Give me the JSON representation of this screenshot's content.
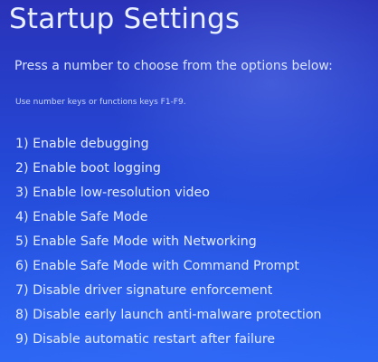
{
  "title": "Startup Settings",
  "subtitle": "Press a number to choose from the options below:",
  "hint": "Use number keys or functions keys F1-F9.",
  "options": [
    {
      "label": "1) Enable debugging"
    },
    {
      "label": "2) Enable boot logging"
    },
    {
      "label": "3) Enable low-resolution video"
    },
    {
      "label": "4) Enable Safe Mode"
    },
    {
      "label": "5) Enable Safe Mode with Networking"
    },
    {
      "label": "6) Enable Safe Mode with Command Prompt"
    },
    {
      "label": "7) Disable driver signature enforcement"
    },
    {
      "label": "8) Disable early launch anti-malware protection"
    },
    {
      "label": "9) Disable automatic restart after failure"
    }
  ]
}
